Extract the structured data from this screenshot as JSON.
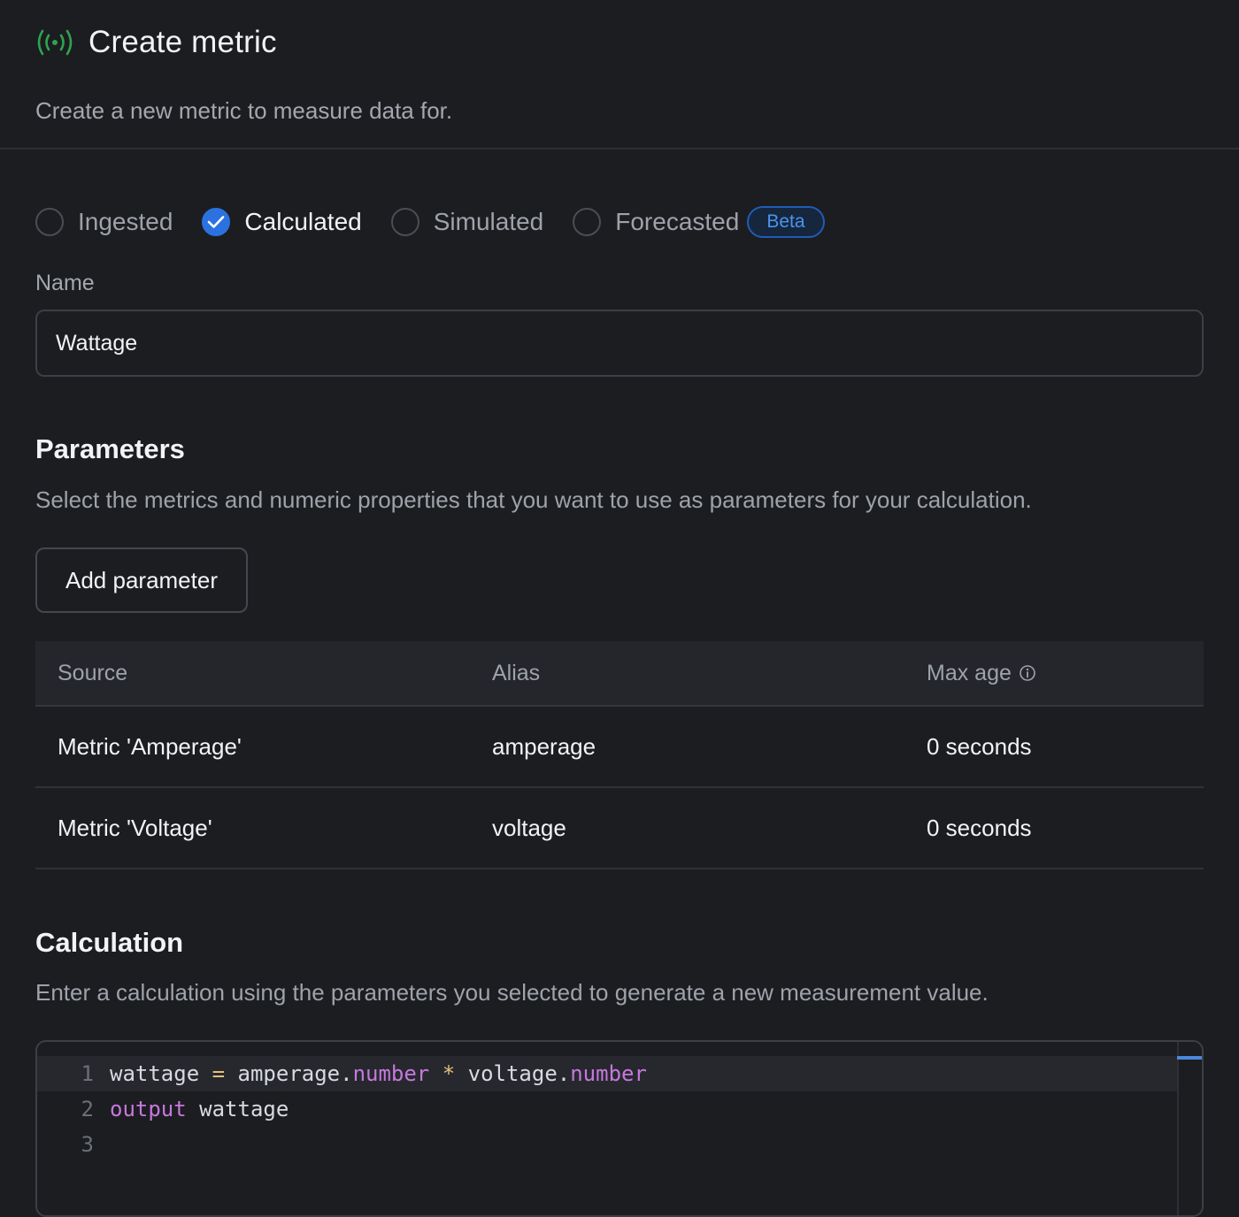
{
  "header": {
    "title": "Create metric",
    "subtitle": "Create a new metric to measure data for.",
    "icon": "signal-broadcast-icon",
    "icon_color": "#2ea44f"
  },
  "metric_types": {
    "options": [
      {
        "label": "Ingested",
        "checked": false
      },
      {
        "label": "Calculated",
        "checked": true
      },
      {
        "label": "Simulated",
        "checked": false
      },
      {
        "label": "Forecasted",
        "checked": false
      }
    ],
    "beta_badge": "Beta"
  },
  "name_field": {
    "label": "Name",
    "value": "Wattage"
  },
  "parameters": {
    "title": "Parameters",
    "description": "Select the metrics and numeric properties that you want to use as parameters for your calculation.",
    "add_button": "Add parameter",
    "columns": [
      "Source",
      "Alias",
      "Max age"
    ],
    "rows": [
      {
        "source": "Metric 'Amperage'",
        "alias": "amperage",
        "max_age": "0 seconds"
      },
      {
        "source": "Metric 'Voltage'",
        "alias": "voltage",
        "max_age": "0 seconds"
      }
    ]
  },
  "calculation": {
    "title": "Calculation",
    "description": "Enter a calculation using the parameters you selected to generate a new measurement value.",
    "line_numbers": [
      "1",
      "2",
      "3"
    ],
    "code": {
      "l1_var": "wattage",
      "l1_eq": "=",
      "l1_a": "amperage.",
      "l1_a_prop": "number",
      "l1_mul": "*",
      "l1_b": "voltage.",
      "l1_b_prop": "number",
      "l2_kw": "output",
      "l2_var": "wattage"
    }
  },
  "colors": {
    "accent": "#2b72e0",
    "background": "#1c1d20",
    "keyword": "#c678dd"
  }
}
